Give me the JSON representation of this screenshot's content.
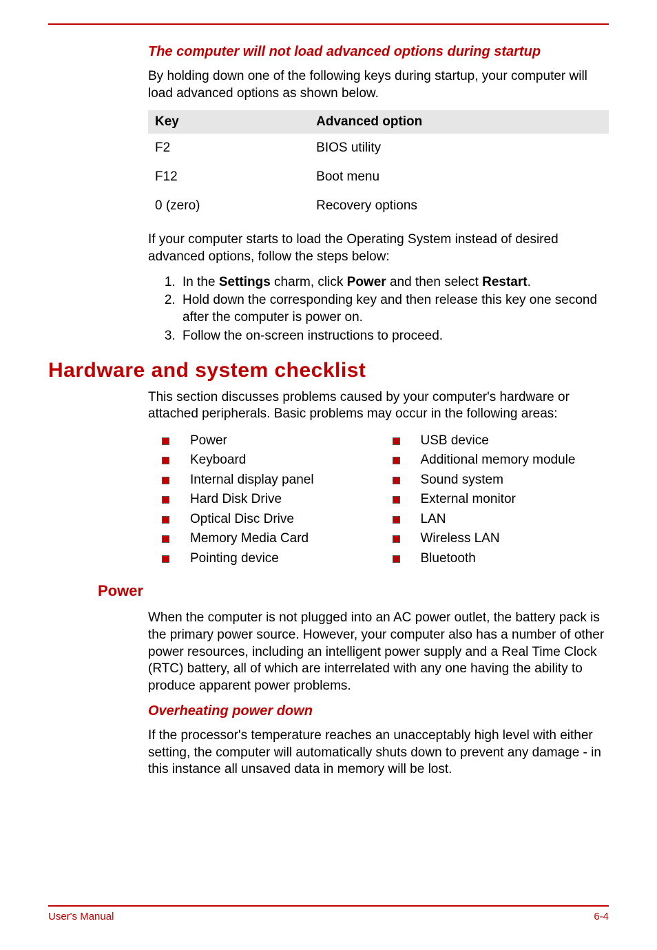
{
  "section1": {
    "heading": "The computer will not load advanced options during startup",
    "intro": "By holding down one of the following keys during startup, your computer will load advanced options as shown below.",
    "table": {
      "headers": [
        "Key",
        "Advanced option"
      ],
      "rows": [
        {
          "key": "F2",
          "option": "BIOS utility"
        },
        {
          "key": "F12",
          "option": "Boot menu"
        },
        {
          "key": "0 (zero)",
          "option": "Recovery options"
        }
      ]
    },
    "after_table": "If your computer starts to load the Operating System instead of desired advanced options, follow the steps below:",
    "steps": {
      "s1_prefix": "In the ",
      "s1_b1": "Settings",
      "s1_mid1": " charm, click ",
      "s1_b2": "Power",
      "s1_mid2": " and then select ",
      "s1_b3": "Restart",
      "s1_suffix": ".",
      "s2": "Hold down the corresponding key and then release this key one second after the computer is power on.",
      "s3": "Follow the on-screen instructions to proceed."
    }
  },
  "section2": {
    "heading": "Hardware and system checklist",
    "intro": "This section discusses problems caused by your computer's hardware or attached peripherals. Basic problems may occur in the following areas:",
    "left_list": [
      "Power",
      "Keyboard",
      "Internal display panel",
      "Hard Disk Drive",
      "Optical Disc Drive",
      "Memory Media Card",
      "Pointing device"
    ],
    "right_list": [
      "USB device",
      "Additional memory module",
      "Sound system",
      "External monitor",
      "LAN",
      "Wireless LAN",
      "Bluetooth"
    ]
  },
  "section3": {
    "heading": "Power",
    "para": "When the computer is not plugged into an AC power outlet, the battery pack is the primary power source. However, your computer also has a number of other power resources, including an intelligent power supply and a Real Time Clock (RTC) battery, all of which are interrelated with any one having the ability to produce apparent power problems."
  },
  "section4": {
    "heading": "Overheating power down",
    "para": "If the processor's temperature reaches an unacceptably high level with either setting, the computer will automatically shuts down to prevent any damage - in this instance all unsaved data in memory will be lost."
  },
  "footer": {
    "left": "User's Manual",
    "right": "6-4"
  }
}
